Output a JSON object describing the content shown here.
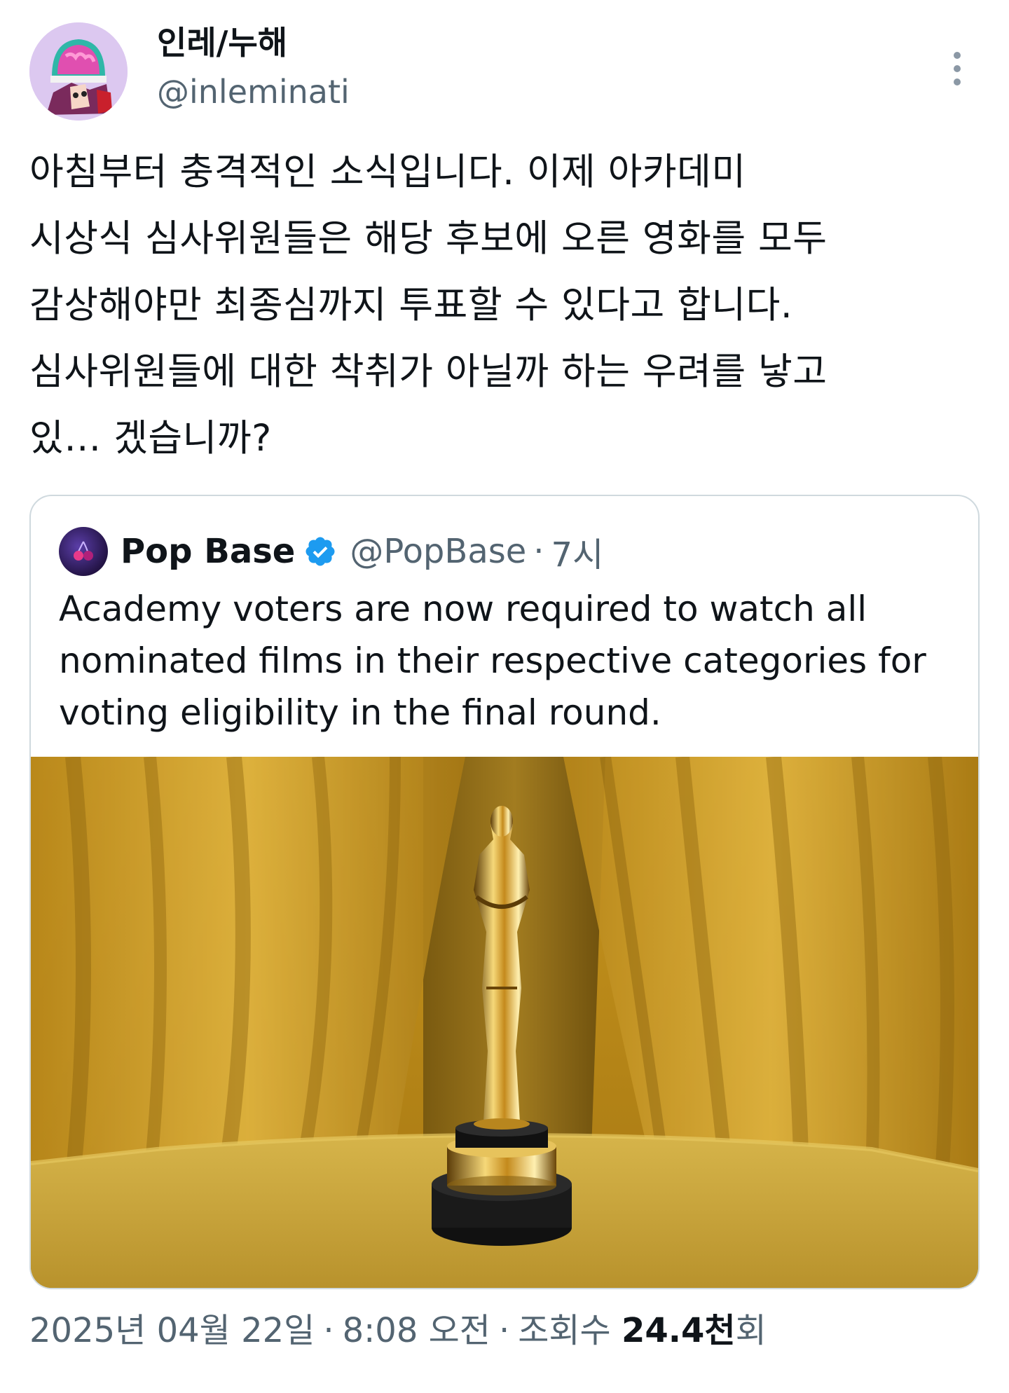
{
  "tweet": {
    "author": {
      "display_name": "인레/누해",
      "handle": "@inleminati"
    },
    "text": "아침부터 충격적인 소식입니다. 이제 아카데미\n시상식 심사위원들은 해당 후보에 오른 영화를 모두\n감상해야만 최종심까지 투표할 수 있다고 합니다.\n심사위원들에 대한 착취가 아닐까 하는 우려를 낳고\n있… 겠습니까?",
    "quote": {
      "author": {
        "display_name": "Pop Base",
        "handle": "@PopBase",
        "time": "7시",
        "separator": "·"
      },
      "text": "Academy voters are now required to watch all nominated films in their respective categories for voting eligibility in the final round."
    },
    "meta": {
      "date": "2025년 04월 22일",
      "time": "8:08 오전",
      "views_label": "조회수",
      "views_count": "24.4천",
      "views_suffix": "회",
      "separator": "·"
    }
  },
  "colors": {
    "accent": "#1d9bf0",
    "text": "#0f1419",
    "secondary": "#536471",
    "border": "#cfd9de"
  }
}
